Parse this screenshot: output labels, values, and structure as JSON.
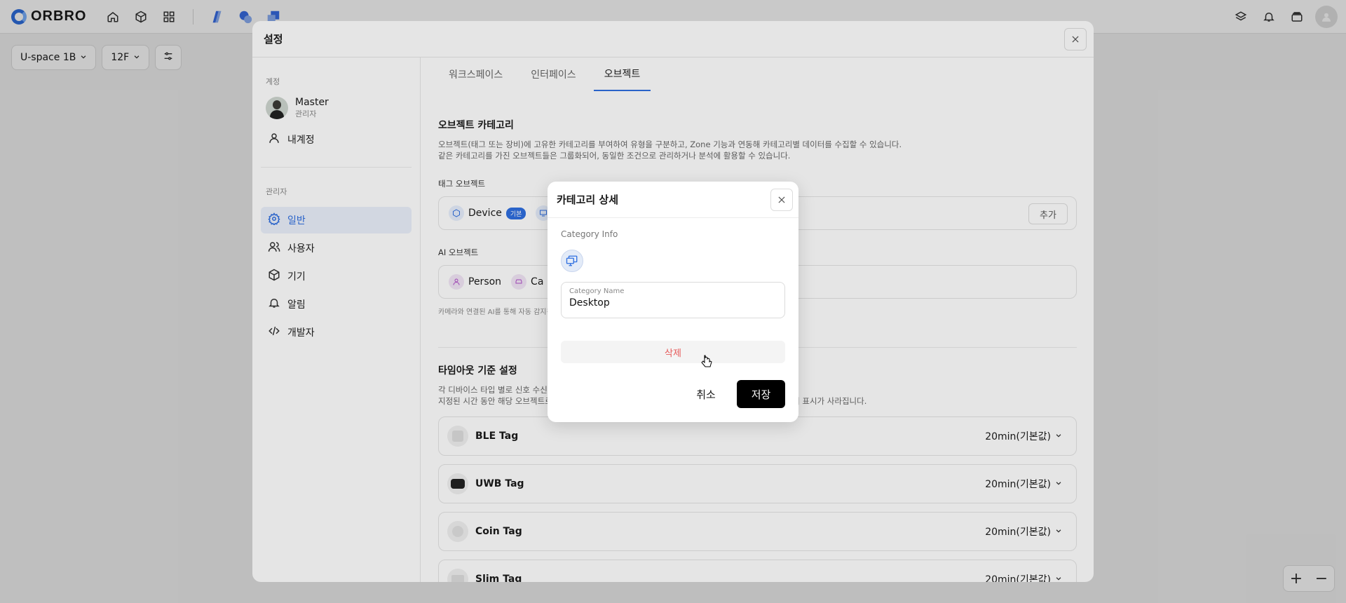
{
  "app": {
    "brand": "ORBRO"
  },
  "floor": {
    "building": "U-space 1B",
    "level": "12F"
  },
  "settings": {
    "title": "설정",
    "account_section": "계정",
    "user": {
      "name": "Master",
      "role": "관리자"
    },
    "my_account": "내계정",
    "admin_section": "관리자",
    "menu": [
      {
        "label": "일반",
        "icon": "gear-icon",
        "active": true
      },
      {
        "label": "사용자",
        "icon": "users-icon",
        "active": false
      },
      {
        "label": "기기",
        "icon": "box-icon",
        "active": false
      },
      {
        "label": "알림",
        "icon": "bell-icon",
        "active": false
      },
      {
        "label": "개발자",
        "icon": "code-icon",
        "active": false
      }
    ],
    "tabs": [
      "워크스페이스",
      "인터페이스",
      "오브젝트"
    ],
    "active_tab": "오브젝트",
    "category": {
      "title": "오브젝트 카테고리",
      "desc1": "오브젝트(태그 또는 장비)에 고유한 카테고리를 부여하여 유형을 구분하고, Zone 기능과 연동해 카테고리별 데이터를 수집할 수 있습니다.",
      "desc2": "같은 카테고리를 가진 오브젝트들은 그룹화되어, 동일한 조건으로 관리하거나 분석에 활용할 수 있습니다."
    },
    "tag_objects": {
      "label": "태그 오브젝트",
      "device": "Device",
      "badge": "기본",
      "add": "추가"
    },
    "ai_objects": {
      "label": "AI 오브젝트",
      "person": "Person",
      "car": "Ca",
      "note": "카메라와 연결된 AI를 통해 자동 감지됨"
    },
    "timeout": {
      "title": "타임아웃 기준 설정",
      "desc1": "각 디바이스 타입 별로 신호 수신이",
      "desc2": "지정된 시간 동안 해당 오브젝트로",
      "desc2_tail": "면에서 표시가 사라집니다.",
      "rows": [
        {
          "name": "BLE Tag",
          "value": "20min(기본값)"
        },
        {
          "name": "UWB Tag",
          "value": "20min(기본값)"
        },
        {
          "name": "Coin Tag",
          "value": "20min(기본값)"
        },
        {
          "name": "Slim Tag",
          "value": "20min(기본값)"
        }
      ]
    }
  },
  "dialog": {
    "title": "카테고리 상세",
    "section": "Category Info",
    "icon": "desktop-icon",
    "field_label": "Category Name",
    "field_value": "Desktop",
    "delete": "삭제",
    "cancel": "취소",
    "save": "저장"
  },
  "colors": {
    "accent": "#2f6fe0",
    "danger": "#e65a5a"
  }
}
